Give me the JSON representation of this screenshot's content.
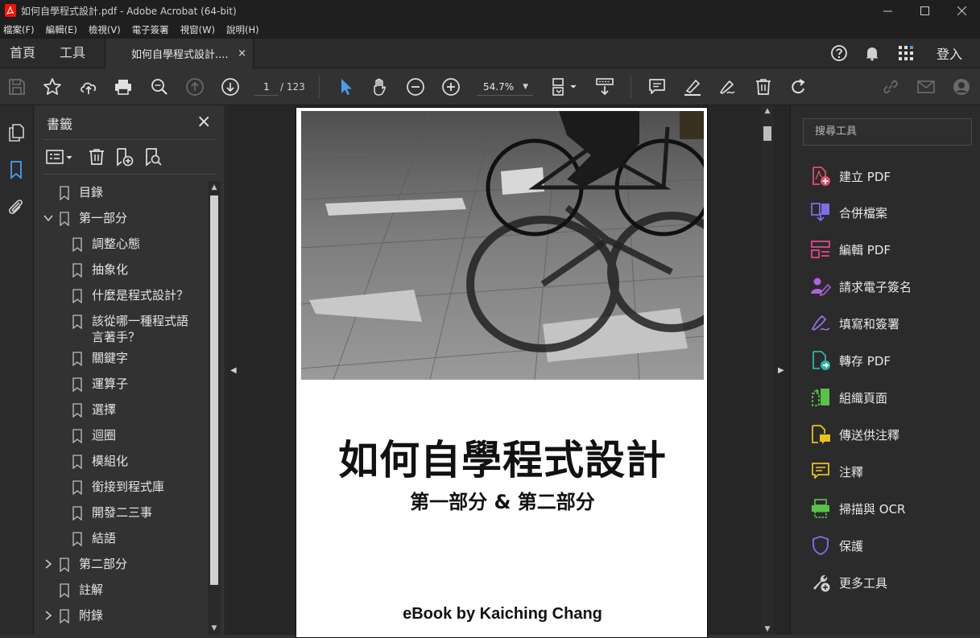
{
  "window": {
    "title": "如何自學程式設計.pdf - Adobe Acrobat (64-bit)"
  },
  "menu": [
    {
      "label": "檔案(F)"
    },
    {
      "label": "編輯(E)"
    },
    {
      "label": "檢視(V)"
    },
    {
      "label": "電子簽署"
    },
    {
      "label": "視窗(W)"
    },
    {
      "label": "說明(H)"
    }
  ],
  "tabs": {
    "home": "首頁",
    "tools": "工具",
    "document": "如何自學程式設計....",
    "close_glyph": "×",
    "login": "登入"
  },
  "toolbar": {
    "page_current": "1",
    "page_total": "/ 123",
    "zoom": "54.7%"
  },
  "bookmarks": {
    "title": "書籤",
    "items": [
      {
        "label": "目錄",
        "level": 0,
        "expander": "none"
      },
      {
        "label": "第一部分",
        "level": 0,
        "expander": "expanded"
      },
      {
        "label": "調整心態",
        "level": 1,
        "expander": "none"
      },
      {
        "label": "抽象化",
        "level": 1,
        "expander": "none"
      },
      {
        "label": "什麼是程式設計？",
        "level": 1,
        "expander": "none"
      },
      {
        "label": "該從哪一種程式語言著手？",
        "level": 1,
        "expander": "none"
      },
      {
        "label": "關鍵字",
        "level": 1,
        "expander": "none"
      },
      {
        "label": "運算子",
        "level": 1,
        "expander": "none"
      },
      {
        "label": "選擇",
        "level": 1,
        "expander": "none"
      },
      {
        "label": "迴圈",
        "level": 1,
        "expander": "none"
      },
      {
        "label": "模組化",
        "level": 1,
        "expander": "none"
      },
      {
        "label": "銜接到程式庫",
        "level": 1,
        "expander": "none"
      },
      {
        "label": "開發二三事",
        "level": 1,
        "expander": "none"
      },
      {
        "label": "結語",
        "level": 1,
        "expander": "none"
      },
      {
        "label": "第二部分",
        "level": 0,
        "expander": "collapsed"
      },
      {
        "label": "註解",
        "level": 0,
        "expander": "none"
      },
      {
        "label": "附錄",
        "level": 0,
        "expander": "collapsed"
      }
    ]
  },
  "document": {
    "cover_title": "如何自學程式設計",
    "cover_subtitle": "第一部分 & 第二部分",
    "cover_author": "eBook by Kaiching Chang"
  },
  "tools_pane": {
    "search_placeholder": "搜尋工具",
    "items": [
      {
        "label": "建立 PDF",
        "icon": "create-pdf-icon",
        "color": "#e0506a"
      },
      {
        "label": "合併檔案",
        "icon": "combine-files-icon",
        "color": "#7b6ee8"
      },
      {
        "label": "編輯 PDF",
        "icon": "edit-pdf-icon",
        "color": "#e04a8a"
      },
      {
        "label": "請求電子簽名",
        "icon": "request-signature-icon",
        "color": "#b062e0"
      },
      {
        "label": "填寫和簽署",
        "icon": "fill-sign-icon",
        "color": "#9a6ee0"
      },
      {
        "label": "轉存 PDF",
        "icon": "export-pdf-icon",
        "color": "#2fb3a8"
      },
      {
        "label": "組織頁面",
        "icon": "organize-pages-icon",
        "color": "#58c24a"
      },
      {
        "label": "傳送供注釋",
        "icon": "send-comment-icon",
        "color": "#e8c21e"
      },
      {
        "label": "注釋",
        "icon": "comment-icon",
        "color": "#e8c21e"
      },
      {
        "label": "掃描與 OCR",
        "icon": "scan-ocr-icon",
        "color": "#58c24a"
      },
      {
        "label": "保護",
        "icon": "protect-icon",
        "color": "#7b6ee8"
      },
      {
        "label": "更多工具",
        "icon": "more-tools-icon",
        "color": "#d0d0d0"
      }
    ]
  },
  "colors": {
    "accent_blue": "#4a9cf0",
    "panel_bg": "#323232",
    "rail_bg": "#2b2b2b"
  }
}
